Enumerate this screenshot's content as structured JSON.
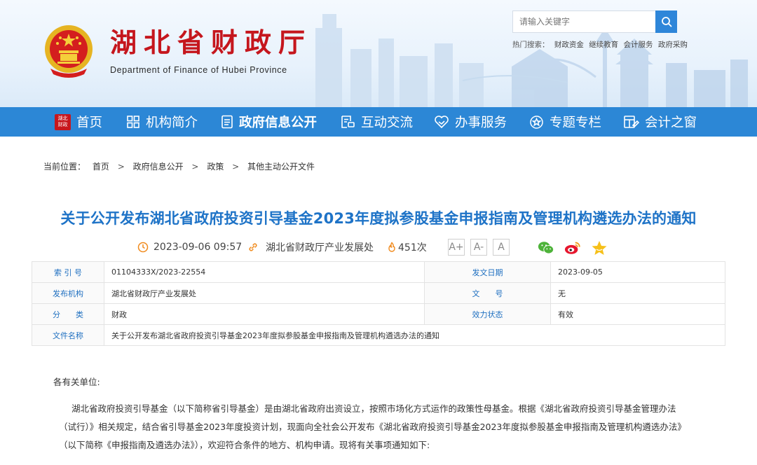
{
  "header": {
    "site_title": "湖北省财政厅",
    "site_subtitle": "Department of Finance of Hubei Province",
    "search": {
      "placeholder": "请输入关键字"
    },
    "hot_label": "热门搜索：",
    "hot_links": [
      "财政资金",
      "继续教育",
      "会计服务",
      "政府采购"
    ]
  },
  "emblem_text": "",
  "nav": {
    "home_icon_text": [
      "湖北",
      "财政"
    ],
    "items": [
      {
        "label": "首页",
        "icon": "home-icon"
      },
      {
        "label": "机构简介",
        "icon": "grid-icon"
      },
      {
        "label": "政府信息公开",
        "icon": "document-icon",
        "active": true
      },
      {
        "label": "互动交流",
        "icon": "chat-doc-icon"
      },
      {
        "label": "办事服务",
        "icon": "heart-hand-icon"
      },
      {
        "label": "专题专栏",
        "icon": "star-circle-icon"
      },
      {
        "label": "会计之窗",
        "icon": "window-edit-icon"
      }
    ]
  },
  "breadcrumb": {
    "label": "当前位置：",
    "items": [
      "首页",
      "政府信息公开",
      "政策",
      "其他主动公开文件"
    ],
    "separator": ">"
  },
  "article": {
    "title": "关于公开发布湖北省政府投资引导基金2023年度拟参股基金申报指南及管理机构遴选办法的通知",
    "datetime": "2023-09-06 09:57",
    "source": "湖北省财政厅产业发展处",
    "views": "451次",
    "font_buttons": [
      "A+",
      "A-",
      "A"
    ]
  },
  "info_table": {
    "index_no_label": "索 引 号",
    "index_no": "01104333X/2023-22554",
    "issue_date_label": "发文日期",
    "issue_date": "2023-09-05",
    "issuer_label": "发布机构",
    "issuer": "湖北省财政厅产业发展处",
    "doc_no_label": "文　　号",
    "doc_no": "无",
    "category_label": "分　　类",
    "category": "财政",
    "status_label": "效力状态",
    "status": "有效",
    "doc_name_label": "文件名称",
    "doc_name": "关于公开发布湖北省政府投资引导基金2023年度拟参股基金申报指南及管理机构遴选办法的通知"
  },
  "body": {
    "salutation": "各有关单位:",
    "p1_line1": "湖北省政府投资引导基金（以下简称省引导基金）是由湖北省政府出资设立，按照市场化方式运作的政策性母基金。根据《湖北省政府投资引导基金管理办法",
    "p1_line2": "（试行）》相关规定，结合省引导基金2023年度投资计划，现面向全社会公开发布《湖北省政府投资引导基金2023年度拟参股基金申报指南及管理机构遴选办法》",
    "p1_line3": "（以下简称《申报指南及遴选办法》），欢迎符合条件的地方、机构申请。现将有关事项通知如下:"
  },
  "colors": {
    "nav_bg": "#2c87d6",
    "title_red": "#c5161d",
    "title_blue": "#1e73c7",
    "accent_orange": "#f08a1c"
  }
}
